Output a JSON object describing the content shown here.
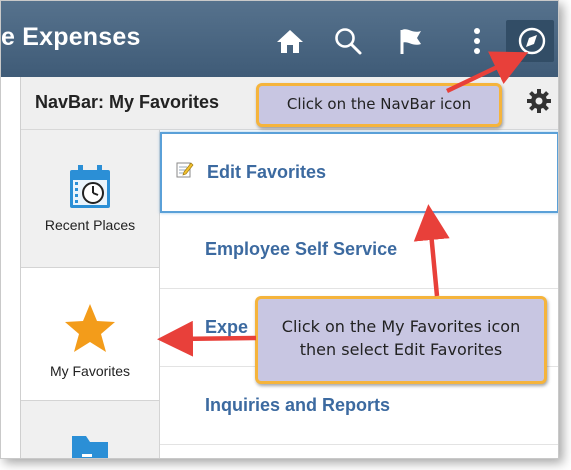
{
  "topbar": {
    "title": "e Expenses",
    "icons": [
      "home-icon",
      "search-icon",
      "flag-icon",
      "more-vertical-icon",
      "navbar-compass-icon"
    ]
  },
  "panel": {
    "title": "NavBar: My Favorites",
    "settings_icon": "gear-icon"
  },
  "sidebar": {
    "items": [
      {
        "label": "Recent Places",
        "icon": "calendar-clock-icon"
      },
      {
        "label": "My Favorites",
        "icon": "star-icon",
        "active": true
      },
      {
        "label": "",
        "icon": "folder-icon"
      }
    ]
  },
  "favorites": {
    "items": [
      {
        "label": "Edit Favorites",
        "icon": "edit-icon",
        "selected": true
      },
      {
        "label": "Employee Self Service"
      },
      {
        "label": "Expe"
      },
      {
        "label": "Inquiries and Reports"
      }
    ]
  },
  "callouts": {
    "navbar": "Click on the NavBar icon",
    "favorites_line1": "Click on the My Favorites icon",
    "favorites_line2": "then select Edit Favorites"
  },
  "colors": {
    "topbar": "#4a6682",
    "link": "#3c6aa0",
    "callout_fill": "#c8c6e2",
    "callout_border": "#f5b43c",
    "arrow": "#e8403a",
    "star": "#f39c1a"
  }
}
